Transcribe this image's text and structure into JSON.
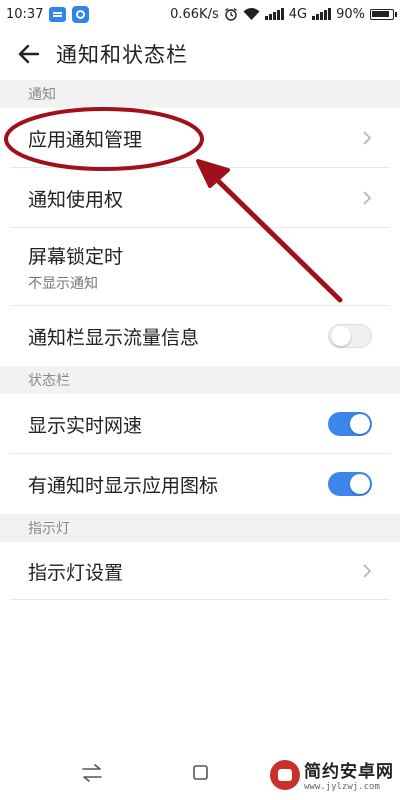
{
  "status_bar": {
    "time": "10:37",
    "speed": "0.66K/s",
    "network": "4G",
    "battery": "90%"
  },
  "header": {
    "title": "通知和状态栏"
  },
  "sections": {
    "notifications": "通知",
    "status_bar": "状态栏",
    "indicator": "指示灯"
  },
  "rows": {
    "app_notification_management": "应用通知管理",
    "notification_access": "通知使用权",
    "lock_screen": "屏幕锁定时",
    "lock_screen_sub": "不显示通知",
    "show_traffic_info": "通知栏显示流量信息",
    "show_realtime_speed": "显示实时网速",
    "show_app_icon": "有通知时显示应用图标",
    "indicator_settings": "指示灯设置"
  },
  "toggles": {
    "show_traffic_info": false,
    "show_realtime_speed": true,
    "show_app_icon": true
  },
  "watermark": {
    "name": "简约安卓网",
    "url": "www.jylzwj.com"
  },
  "colors": {
    "accent": "#3b86e8",
    "annotation": "#a0101a",
    "section_bg": "#f2f2f2"
  }
}
